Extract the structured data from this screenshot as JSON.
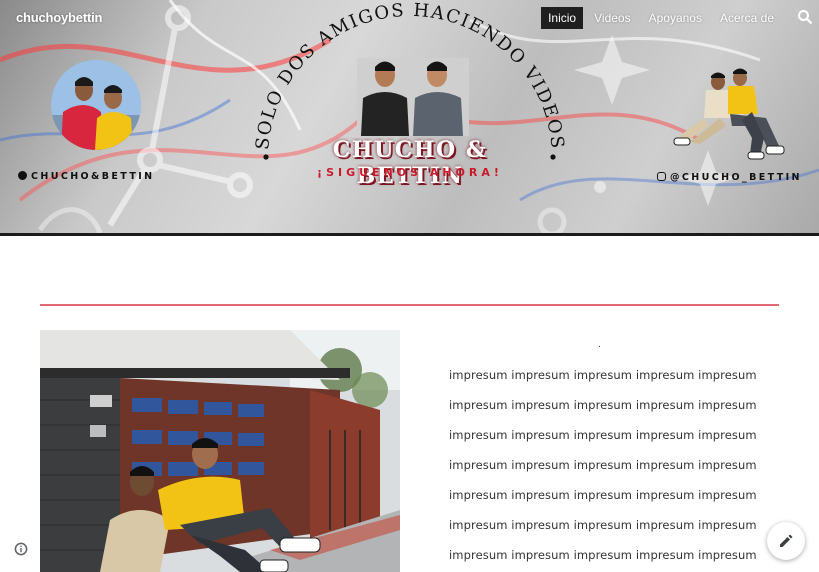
{
  "site": {
    "title": "chuchoybettin"
  },
  "nav": {
    "items": [
      {
        "label": "Inicio",
        "active": true
      },
      {
        "label": "Videos",
        "active": false
      },
      {
        "label": "Apoyanos",
        "active": false
      },
      {
        "label": "Acerca de",
        "active": false
      }
    ],
    "search_icon": "search-icon"
  },
  "banner": {
    "arc_text": "SOLO DOS AMIGOS HACIENDO VIDEOS",
    "main_title": "CHUCHO & BETTIN",
    "subtitle": "¡SIGUENOS AHORA!",
    "handle_left": "CHUCHO&BETTIN",
    "handle_right": "@CHUCHO_BETTIN",
    "colors": {
      "title_shadow": "#7e1520",
      "subtitle": "#c91a2b"
    }
  },
  "content": {
    "divider_color": "#e06b72",
    "dot": ".",
    "lines": [
      "impresum impresum impresum impresum impresum",
      "impresum impresum impresum impresum impresum",
      "impresum impresum impresum impresum impresum",
      "impresum impresum impresum impresum impresum",
      "impresum impresum impresum impresum impresum",
      "impresum impresum impresum impresum impresum",
      "impresum impresum impresum impresum impresum"
    ]
  },
  "icons": {
    "info": "info-icon",
    "edit": "pencil-icon",
    "instagram": "instagram-icon"
  }
}
